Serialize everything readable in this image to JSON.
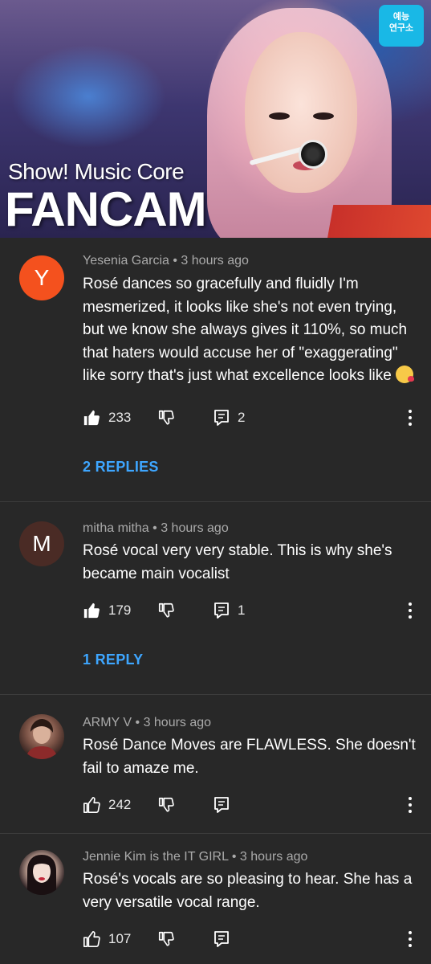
{
  "thumbnail": {
    "title_small": "Show! Music Core",
    "title_big": "FANCAM",
    "logo_text": "예능\n연구소"
  },
  "comments": [
    {
      "avatar_letter": "Y",
      "avatar_color": "#f4511e",
      "author": "Yesenia Garcia",
      "time": "3 hours ago",
      "text": "Rosé dances so gracefully and fluidly I'm mesmerized, it looks like she's not even trying, but we know she always gives it 110%, so much that haters would accuse her of \"exaggerating\" like sorry that's just what excellence looks like",
      "emoji": "kissing-heart-emoji",
      "likes": "233",
      "reply_count": "2",
      "replies_label": "2 REPLIES",
      "liked": true
    },
    {
      "avatar_letter": "M",
      "avatar_color": "#4a2b25",
      "author": "mitha mitha",
      "time": "3 hours ago",
      "text": "Rosé vocal very very stable. This is why she's became main vocalist",
      "likes": "179",
      "reply_count": "1",
      "replies_label": "1 REPLY",
      "liked": true
    },
    {
      "avatar_letter": "",
      "avatar_color": "#3a2a28",
      "author": "ARMY V",
      "time": "3 hours ago",
      "text": "Rosé Dance Moves are FLAWLESS. She doesn't fail to amaze me.",
      "likes": "242",
      "reply_count": "",
      "liked": false
    },
    {
      "avatar_letter": "",
      "avatar_color": "#2b1e22",
      "author": "Jennie Kim is the IT GIRL",
      "time": "3 hours ago",
      "text": "Rosé's vocals are so pleasing to hear. She has a very versatile vocal range.",
      "likes": "107",
      "reply_count": "",
      "liked": false
    }
  ],
  "colors": {
    "background": "#282828",
    "link": "#3ea6ff",
    "meta": "#aaaaaa"
  }
}
